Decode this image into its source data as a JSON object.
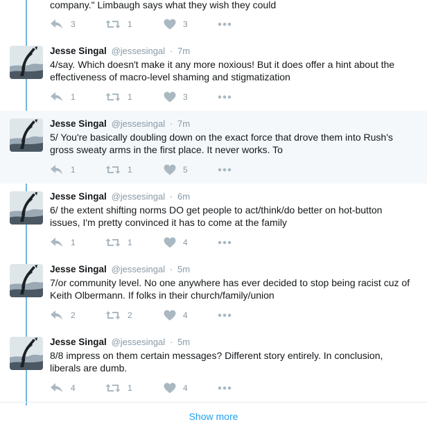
{
  "partial_tweet": {
    "text": "company.\" Limbaugh says what they wish they could",
    "replies": "3",
    "retweets": "1",
    "likes": "3"
  },
  "tweets": [
    {
      "name": "Jesse Singal",
      "handle": "@jessesingal",
      "sep": "·",
      "time": "7m",
      "text": "4/say. Which doesn't make it any more noxious! But it does offer a hint about the effectiveness of macro-level shaming and stigmatization",
      "replies": "1",
      "retweets": "1",
      "likes": "3"
    },
    {
      "name": "Jesse Singal",
      "handle": "@jessesingal",
      "sep": "·",
      "time": "7m",
      "text": "5/ You're basically doubling down on the exact force that drove them into Rush's gross sweaty arms in the first place. It never works. To",
      "replies": "1",
      "retweets": "1",
      "likes": "5"
    },
    {
      "name": "Jesse Singal",
      "handle": "@jessesingal",
      "sep": "·",
      "time": "6m",
      "text": "6/ the extent shifting norms DO get people to act/think/do better on hot-button issues, I'm pretty convinced it has to come at the family",
      "replies": "1",
      "retweets": "1",
      "likes": "4"
    },
    {
      "name": "Jesse Singal",
      "handle": "@jessesingal",
      "sep": "·",
      "time": "5m",
      "text": "7/or community level. No one anywhere has ever decided to stop being racist cuz of Keith Olbermann. If folks in their church/family/union",
      "replies": "2",
      "retweets": "2",
      "likes": "4"
    },
    {
      "name": "Jesse Singal",
      "handle": "@jessesingal",
      "sep": "·",
      "time": "5m",
      "text": "8/8 impress on them certain messages? Different story entirely. In conclusion, liberals are dumb.",
      "replies": "4",
      "retweets": "1",
      "likes": "4"
    }
  ],
  "show_more_label": "Show more",
  "colors": {
    "thread_line": "#71b6e0",
    "highlight_bg": "#f5f8fa",
    "muted": "#8899a6",
    "link": "#1da1f2"
  },
  "icons": [
    "avatar-image",
    "reply-icon",
    "retweet-icon",
    "heart-icon",
    "more-icon"
  ]
}
